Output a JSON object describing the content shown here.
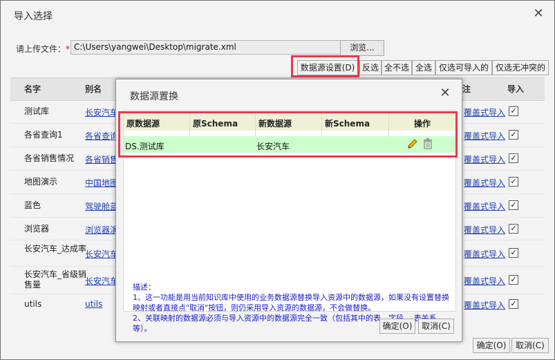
{
  "outer": {
    "title": "导入选择",
    "close": "✕",
    "upload_label": "请上传文件：",
    "required_mark": "*",
    "file_path": "C:\\Users\\yangwei\\Desktop\\migrate.xml",
    "browse_label": "浏览...",
    "toolbar": {
      "ds_settings": "数据源设置(D)",
      "invert": "反选",
      "select_none": "全不选",
      "select_all": "全选",
      "only_importable": "仅选可导入的",
      "only_no_conflict": "仅选无冲突的"
    },
    "columns": {
      "name": "名字",
      "alias": "别名",
      "note": "注",
      "import": "导入"
    },
    "rows": [
      {
        "name": "测试库",
        "alias": "长安汽车",
        "mode": "覆盖式导入"
      },
      {
        "name": "各省查询1",
        "alias": "各省查询1",
        "mode": "覆盖式导入"
      },
      {
        "name": "各省销售情况",
        "alias": "各省销售情况",
        "mode": "覆盖式导入"
      },
      {
        "name": "地图演示",
        "alias": "中国地图",
        "mode": "覆盖式导入"
      },
      {
        "name": "蓝色",
        "alias": "驾驶舱蓝色",
        "mode": "覆盖式导入"
      },
      {
        "name": "浏览器",
        "alias": "浏览器演示",
        "mode": "覆盖式导入"
      },
      {
        "name": "长安汽车_达成率",
        "alias": "长安汽车_达成率",
        "mode": "覆盖式导入"
      },
      {
        "name": "长安汽车_省级销售量",
        "alias": "长安汽车_省级",
        "mode": "覆盖式导入"
      },
      {
        "name": "utils",
        "alias": "utils",
        "mode": "覆盖式导入"
      }
    ],
    "ok_label": "确定(O)",
    "cancel_label": "取消(C)"
  },
  "modal": {
    "title": "数据源置换",
    "close": "✕",
    "columns": {
      "orig_ds": "原数据源",
      "orig_schema": "原Schema",
      "new_ds": "新数据源",
      "new_schema": "新Schema",
      "action": "操作"
    },
    "row": {
      "orig_ds": "DS.测试库",
      "orig_schema": "",
      "new_ds": "长安汽车",
      "new_schema": ""
    },
    "desc_title": "描述：",
    "desc_line1": "1、这一功能是用当前知识库中使用的业务数据源替换导入资源中的数据源，如果没有设置替换映射或者直接点\"取消\"按钮，则仍采用导入资源的数据源，不会做替换。",
    "desc_line2": "2、关联映射的数据源必须与导入资源中的数据源完全一致（包括其中的表，字段 ，表关系等）。",
    "ok_label": "确定(O)",
    "cancel_label": "取消(C)"
  },
  "colors": {
    "highlight": "#e8394a",
    "link": "#1f3fb6",
    "row_green": "#ccffcc",
    "header_yellow": "#f0f0d6",
    "desc_blue": "#1a1acc"
  }
}
